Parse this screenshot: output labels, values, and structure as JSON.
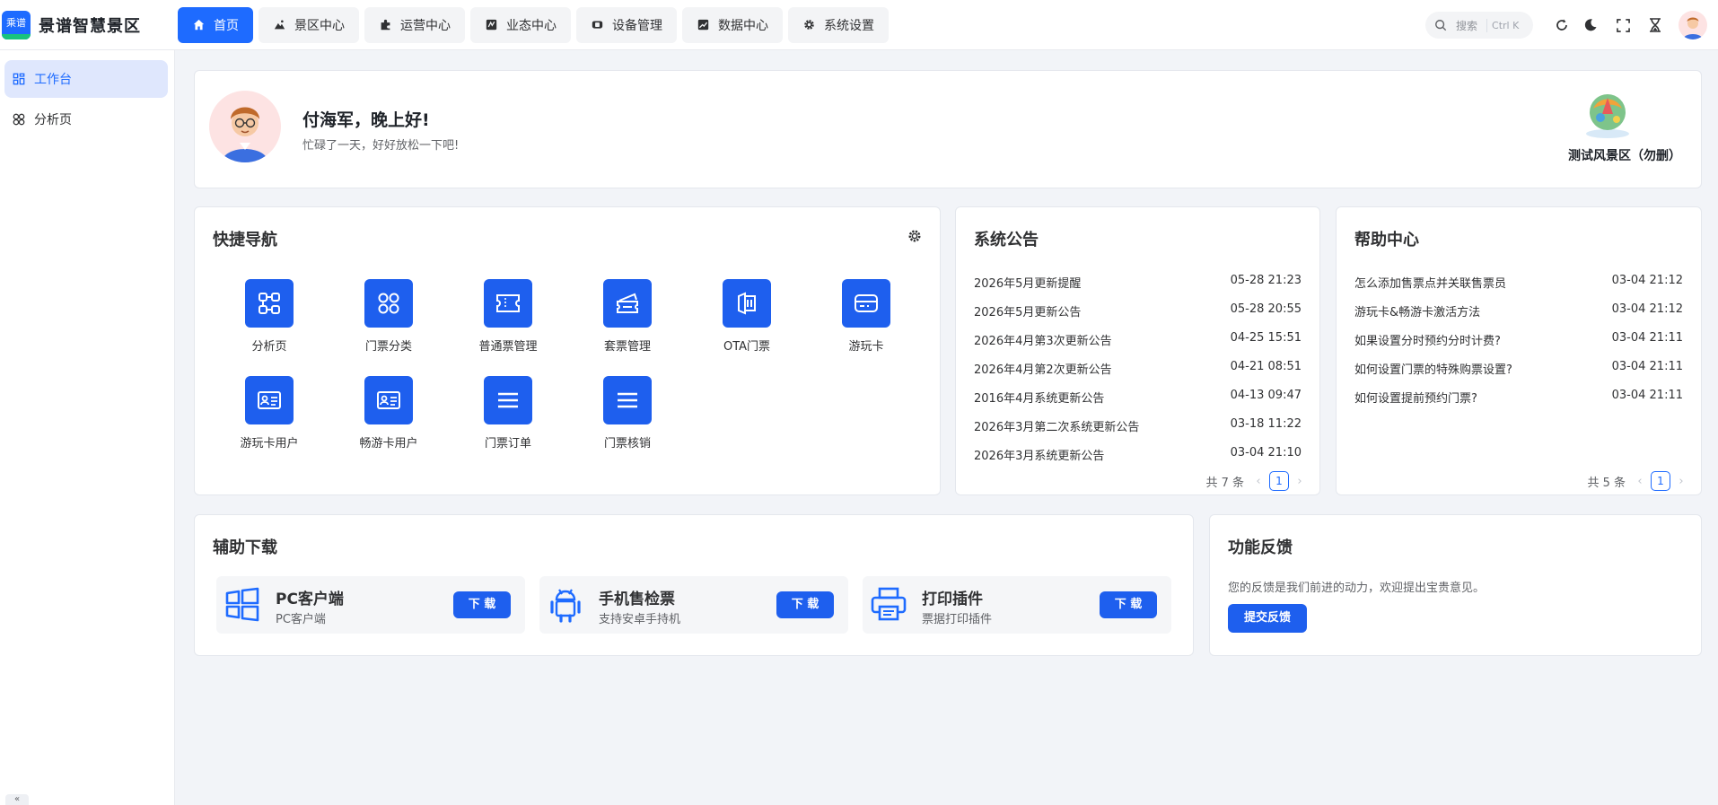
{
  "brand": {
    "logo_text": "乘谱",
    "title": "景谱智慧景区"
  },
  "menu": [
    {
      "label": "首页",
      "icon": "home-icon",
      "active": true
    },
    {
      "label": "景区中心",
      "icon": "landscape-icon"
    },
    {
      "label": "运营中心",
      "icon": "puzzle-icon"
    },
    {
      "label": "业态中心",
      "icon": "business-icon"
    },
    {
      "label": "设备管理",
      "icon": "device-icon"
    },
    {
      "label": "数据中心",
      "icon": "chart-icon"
    },
    {
      "label": "系统设置",
      "icon": "gear-icon"
    }
  ],
  "search": {
    "placeholder": "搜索",
    "shortcut": "Ctrl K"
  },
  "sidebar": {
    "items": [
      {
        "label": "工作台",
        "icon": "workbench-icon",
        "active": true
      },
      {
        "label": "分析页",
        "icon": "analysis-icon"
      }
    ],
    "collapse_label": "«"
  },
  "welcome": {
    "greeting": "付海军，晚上好!",
    "subtitle": "忙碌了一天，好好放松一下吧!",
    "scenic_name": "测试风景区（勿删）"
  },
  "quick_nav": {
    "title": "快捷导航",
    "items": [
      {
        "label": "分析页",
        "icon": "flow-icon"
      },
      {
        "label": "门票分类",
        "icon": "grid-icon"
      },
      {
        "label": "普通票管理",
        "icon": "ticket-icon"
      },
      {
        "label": "套票管理",
        "icon": "package-ticket-icon"
      },
      {
        "label": "OTA门票",
        "icon": "ota-icon"
      },
      {
        "label": "游玩卡",
        "icon": "card-icon"
      },
      {
        "label": "游玩卡用户",
        "icon": "id-card-icon"
      },
      {
        "label": "畅游卡用户",
        "icon": "id-card-icon"
      },
      {
        "label": "门票订单",
        "icon": "menu-lines-icon"
      },
      {
        "label": "门票核销",
        "icon": "menu-lines-icon"
      }
    ]
  },
  "notices": {
    "title": "系统公告",
    "items": [
      {
        "title": "2026年5月更新提醒",
        "date": "05-28 21:23"
      },
      {
        "title": "2026年5月更新公告",
        "date": "05-28 20:55"
      },
      {
        "title": "2026年4月第3次更新公告",
        "date": "04-25 15:51"
      },
      {
        "title": "2026年4月第2次更新公告",
        "date": "04-21 08:51"
      },
      {
        "title": "2016年4月系统更新公告",
        "date": "04-13 09:47"
      },
      {
        "title": "2026年3月第二次系统更新公告",
        "date": "03-18 11:22"
      },
      {
        "title": "2026年3月系统更新公告",
        "date": "03-04 21:10"
      }
    ],
    "total_text": "共 7 条",
    "page": "1"
  },
  "help": {
    "title": "帮助中心",
    "items": [
      {
        "title": "怎么添加售票点并关联售票员",
        "date": "03-04 21:12"
      },
      {
        "title": "游玩卡&畅游卡激活方法",
        "date": "03-04 21:12"
      },
      {
        "title": "如果设置分时预约分时计费?",
        "date": "03-04 21:11"
      },
      {
        "title": "如何设置门票的特殊购票设置?",
        "date": "03-04 21:11"
      },
      {
        "title": "如何设置提前预约门票?",
        "date": "03-04 21:11"
      }
    ],
    "total_text": "共 5 条",
    "page": "1"
  },
  "downloads": {
    "title": "辅助下载",
    "items": [
      {
        "name": "PC客户端",
        "desc": "PC客户端",
        "button": "下 载",
        "icon": "windows-icon"
      },
      {
        "name": "手机售检票",
        "desc": "支持安卓手持机",
        "button": "下 载",
        "icon": "android-icon"
      },
      {
        "name": "打印插件",
        "desc": "票据打印插件",
        "button": "下 载",
        "icon": "printer-icon"
      }
    ]
  },
  "feedback": {
    "title": "功能反馈",
    "text": "您的反馈是我们前进的动力，欢迎提出宝贵意见。",
    "button": "提交反馈"
  },
  "colors": {
    "primary": "#1e6bff",
    "icon_bg": "#1e5fee",
    "page_bg": "#f2f4f8"
  }
}
